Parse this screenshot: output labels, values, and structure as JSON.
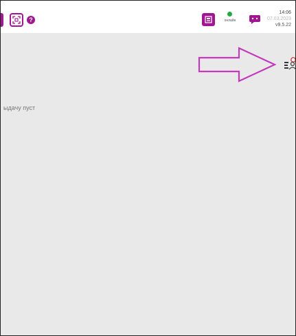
{
  "topbar": {
    "help_glyph": "?",
    "status_label": "онлайн",
    "time": "14:06",
    "date": "07.03.2023",
    "version": "v9.5.22"
  },
  "main": {
    "empty_message": "ыдачу пуст"
  },
  "colors": {
    "brand": "#a0178f",
    "online": "#1eaa3c",
    "background": "#e9e9e9"
  },
  "icons": [
    "scan-icon",
    "help-icon",
    "cash-register-icon",
    "chat-icon",
    "pointer-arrow-icon",
    "courier-profile-icon"
  ]
}
